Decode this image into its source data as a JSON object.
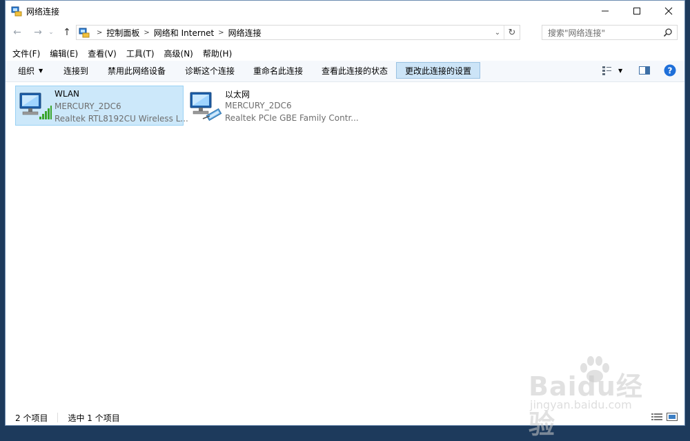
{
  "window": {
    "title": "网络连接",
    "controls": {
      "minimize_icon": "minimize-icon",
      "maximize_icon": "maximize-icon",
      "close_icon": "close-icon"
    }
  },
  "address": {
    "breadcrumbs": [
      "控制面板",
      "网络和 Internet",
      "网络连接"
    ],
    "search_placeholder": "搜索\"网络连接\""
  },
  "menu": [
    "文件(F)",
    "编辑(E)",
    "查看(V)",
    "工具(T)",
    "高级(N)",
    "帮助(H)"
  ],
  "commands": [
    {
      "label": "组织",
      "has_dropdown": true
    },
    {
      "label": "连接到"
    },
    {
      "label": "禁用此网络设备"
    },
    {
      "label": "诊断这个连接"
    },
    {
      "label": "重命名此连接"
    },
    {
      "label": "查看此连接的状态"
    },
    {
      "label": "更改此连接的设置",
      "selected": true
    }
  ],
  "connections": [
    {
      "name": "WLAN",
      "network": "MERCURY_2DC6",
      "adapter": "Realtek RTL8192CU Wireless L...",
      "selected": true,
      "icon": "wifi-adapter-icon"
    },
    {
      "name": "以太网",
      "network": "MERCURY_2DC6",
      "adapter": "Realtek PCIe GBE Family Contr...",
      "selected": false,
      "icon": "ethernet-adapter-icon"
    }
  ],
  "status": {
    "count": "2 个项目",
    "selection": "选中 1 个项目"
  },
  "watermark": {
    "brand": "Baidu经验",
    "domain": "jingyan.baidu.com"
  },
  "colors": {
    "selection": "#cce8fa",
    "selection_border": "#99d1f4",
    "command_selected": "#cce4f7",
    "help": "#1e6fd9"
  }
}
